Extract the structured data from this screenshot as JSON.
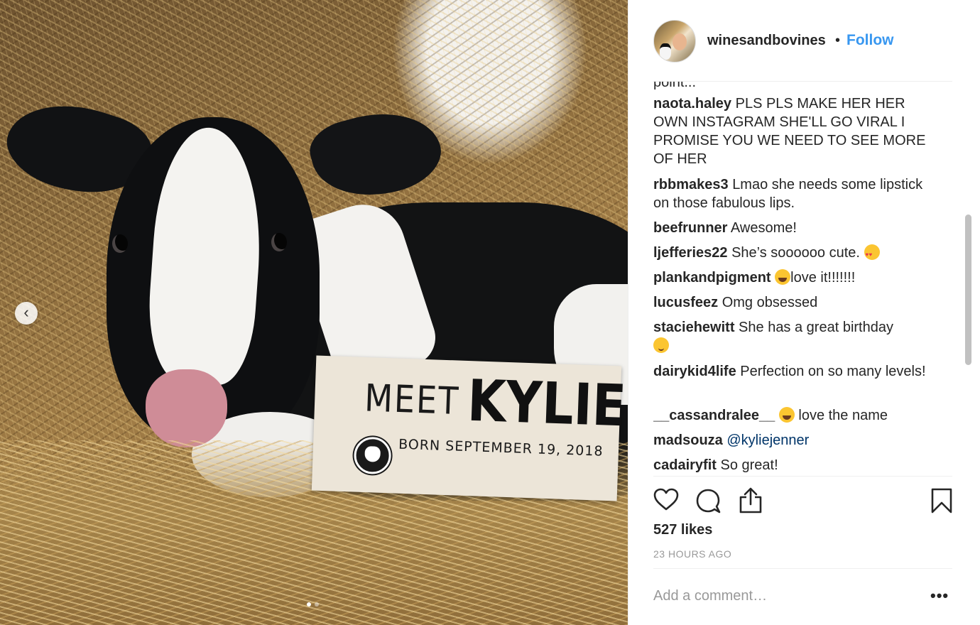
{
  "photo": {
    "sign_meet": "MEET",
    "sign_name": "KYLIE",
    "sign_born": "BORN SEPTEMBER 19, 2018",
    "carousel_prev_icon": "chevron-left-icon",
    "carousel_dots": 2,
    "carousel_active_dot": 1
  },
  "post": {
    "username": "winesandbovines",
    "bullet": "•",
    "follow_label": "Follow",
    "partial_comment": "point...",
    "comments": [
      {
        "user": "naota.haley",
        "text": "PLS PLS MAKE HER HER OWN INSTAGRAM SHE'LL GO VIRAL I PROMISE YOU WE NEED TO SEE MORE OF HER"
      },
      {
        "user": "rbbmakes3",
        "text": "Lmao she needs some lipstick on those fabulous lips."
      },
      {
        "user": "beefrunner",
        "text": "Awesome!"
      },
      {
        "user": "ljefferies22",
        "text": "She’s soooooo cute.",
        "emoji": "heart-eyes-emoji"
      },
      {
        "user": "plankandpigment",
        "text": "love it!!!!!!!",
        "emoji": "tears-of-joy-emoji"
      },
      {
        "user": "lucusfeez",
        "text": "Omg obsessed"
      },
      {
        "user": "staciehewitt",
        "text": "She has a great birthday",
        "emoji": "wink-emoji"
      },
      {
        "user": "dairykid4life",
        "text": "Perfection on so many levels!"
      },
      {
        "user": "__cassandralee__",
        "text": "love the name",
        "emoji": "tears-of-joy-emoji"
      },
      {
        "user": "madsouza",
        "mention": "@kyliejenner"
      },
      {
        "user": "cadairyfit",
        "text": "So great!"
      }
    ],
    "likes": "527 likes",
    "time": "23 HOURS AGO",
    "add_comment_placeholder": "Add a comment…",
    "more_label": "•••"
  },
  "colors": {
    "accent": "#3897f0",
    "text": "#262626",
    "muted": "#999999",
    "mention": "#003569"
  }
}
